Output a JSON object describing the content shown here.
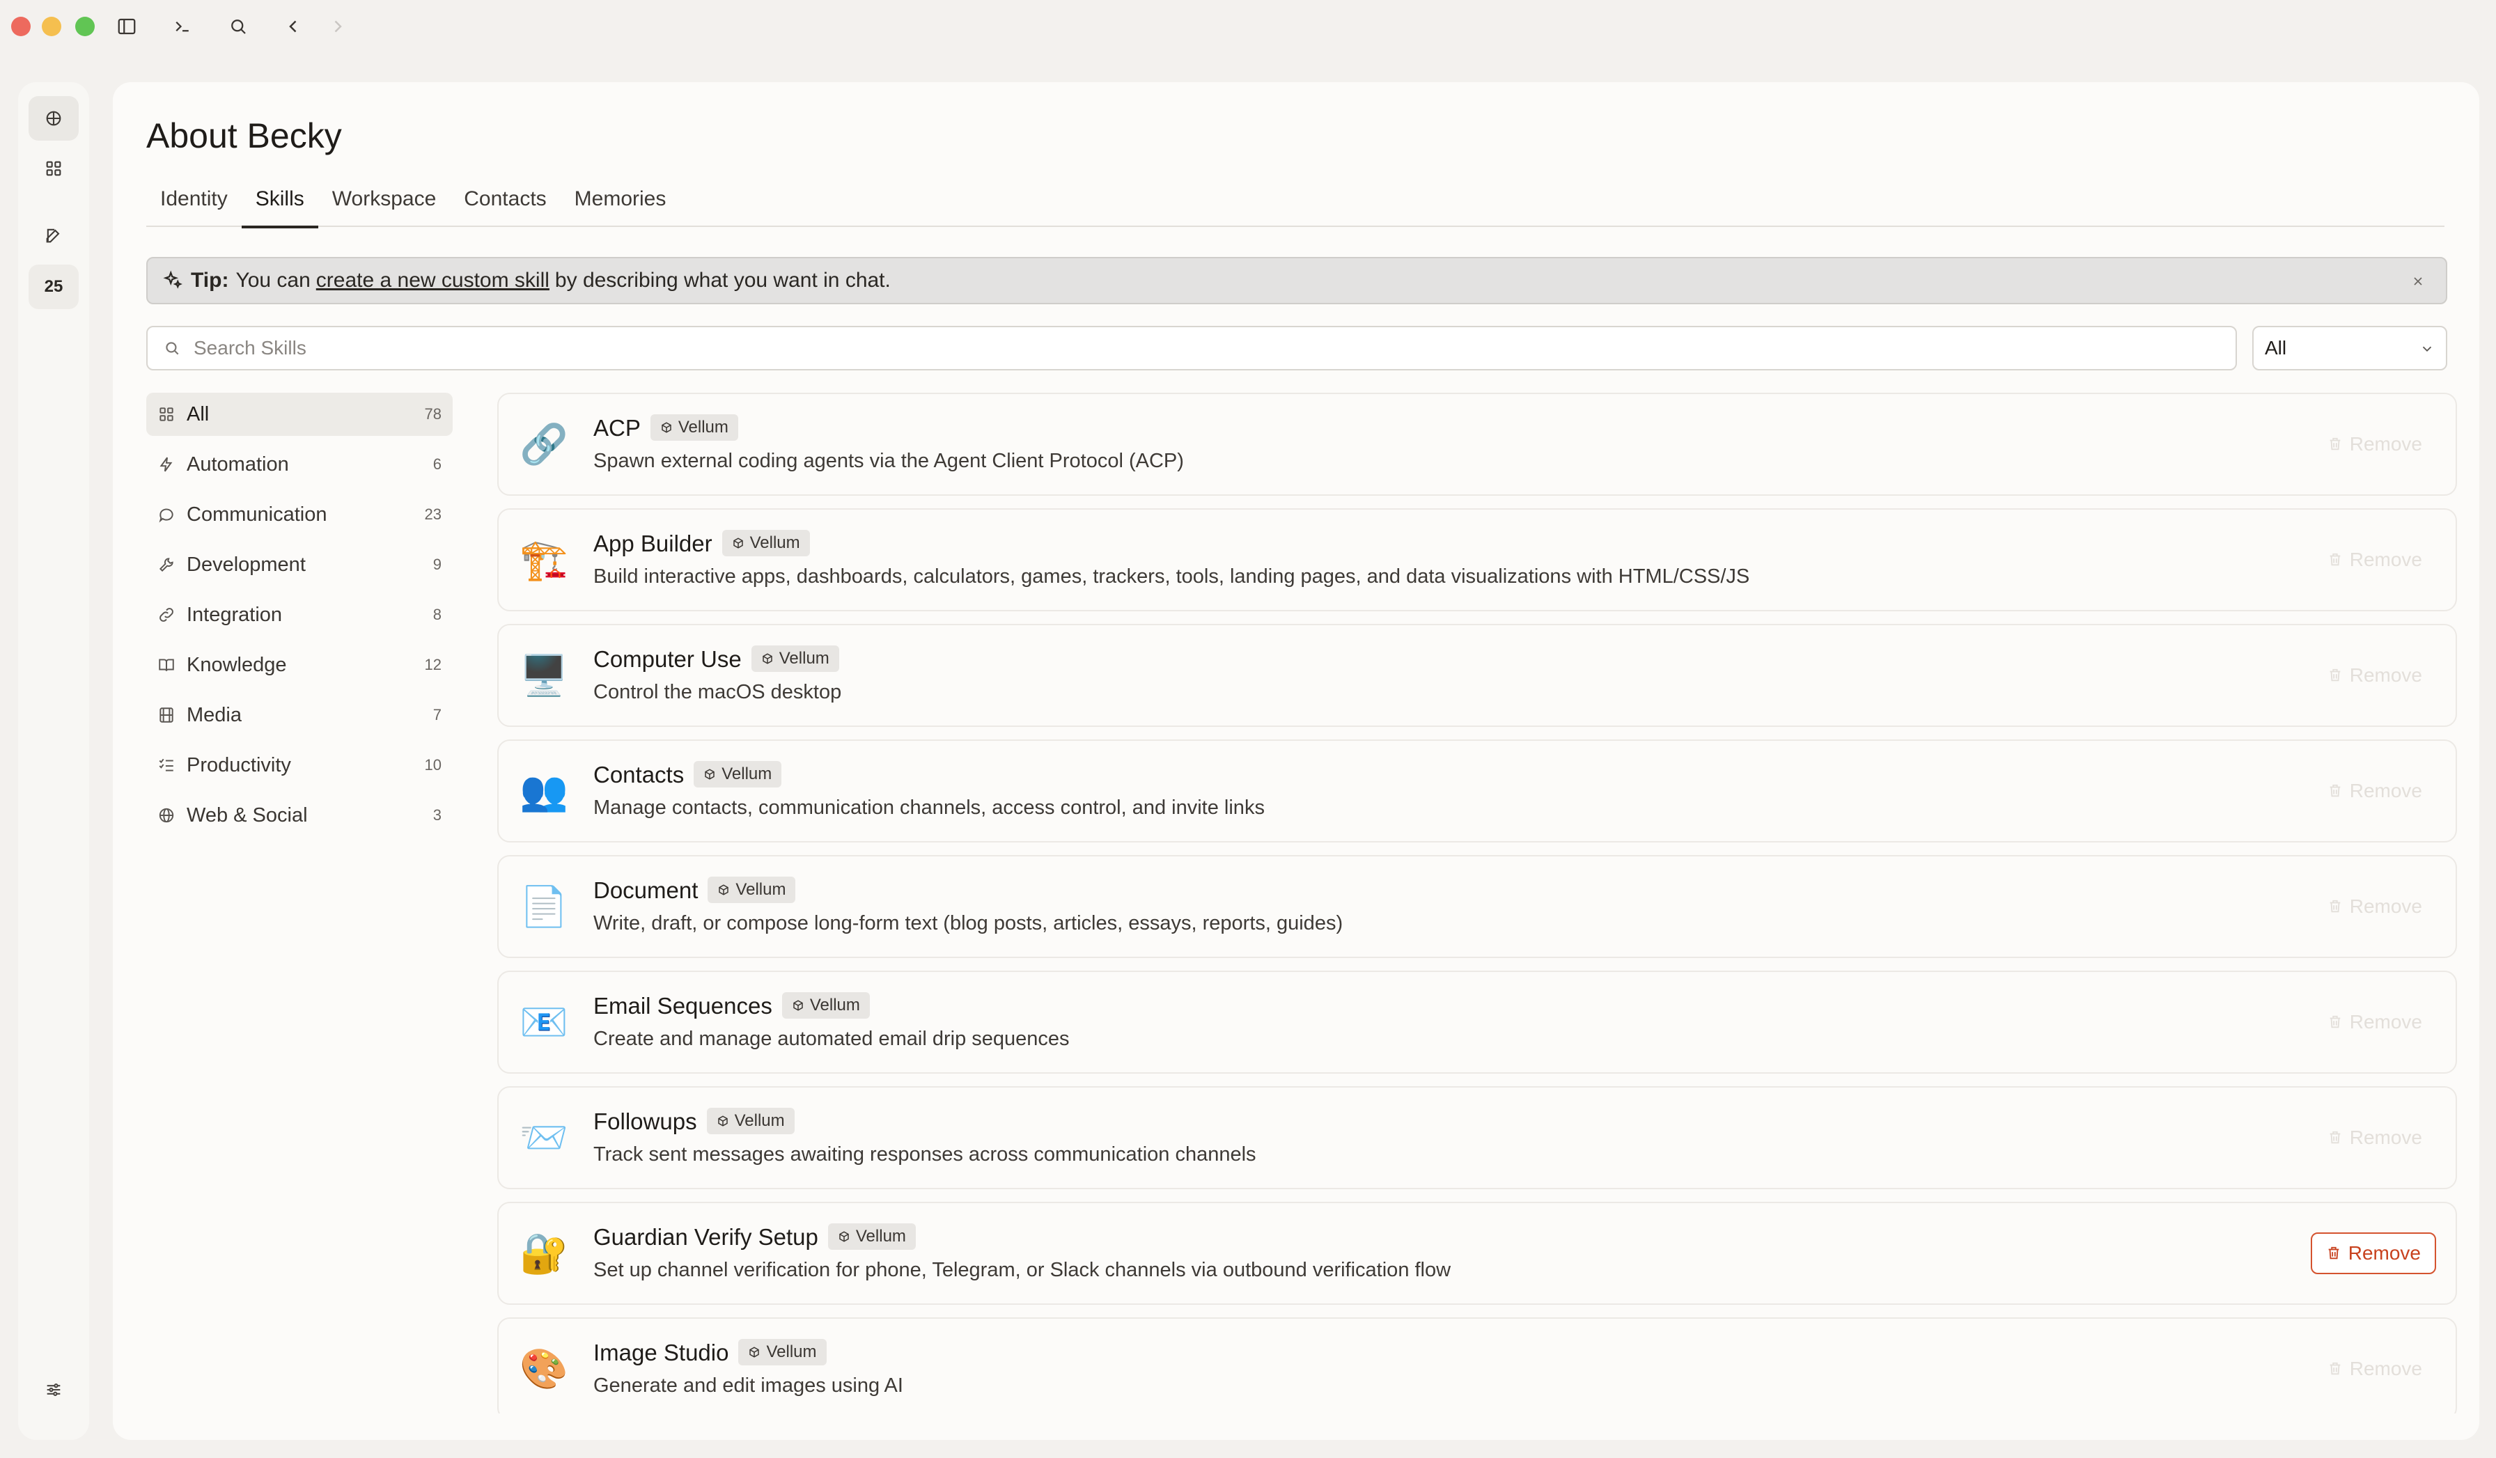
{
  "page": {
    "title": "About Becky",
    "tabs": [
      "Identity",
      "Skills",
      "Workspace",
      "Contacts",
      "Memories"
    ],
    "selected_tab": "Skills"
  },
  "rail": {
    "badge": "25"
  },
  "tip": {
    "bold": "Tip:",
    "text_before": "You can",
    "link": "create a new custom skill",
    "text_after": "by describing what you want in chat."
  },
  "search": {
    "placeholder": "Search Skills",
    "filter_value": "All"
  },
  "categories": [
    {
      "label": "All",
      "count": "78",
      "icon": "grid-icon"
    },
    {
      "label": "Automation",
      "count": "6",
      "icon": "bolt-icon"
    },
    {
      "label": "Communication",
      "count": "23",
      "icon": "chat-bubble-icon"
    },
    {
      "label": "Development",
      "count": "9",
      "icon": "wrench-icon"
    },
    {
      "label": "Integration",
      "count": "8",
      "icon": "link-icon"
    },
    {
      "label": "Knowledge",
      "count": "12",
      "icon": "book-icon"
    },
    {
      "label": "Media",
      "count": "7",
      "icon": "film-icon"
    },
    {
      "label": "Productivity",
      "count": "10",
      "icon": "checklist-icon"
    },
    {
      "label": "Web & Social",
      "count": "3",
      "icon": "globe-icon"
    }
  ],
  "skills": [
    {
      "name": "ACP",
      "badge": "Vellum",
      "desc": "Spawn external coding agents via the Agent Client Protocol (ACP)",
      "emoji": "🔗",
      "remove": "Remove"
    },
    {
      "name": "App Builder",
      "badge": "Vellum",
      "desc": "Build interactive apps, dashboards, calculators, games, trackers, tools, landing pages, and data visualizations with HTML/CSS/JS",
      "emoji": "🏗️",
      "remove": "Remove"
    },
    {
      "name": "Computer Use",
      "badge": "Vellum",
      "desc": "Control the macOS desktop",
      "emoji": "🖥️",
      "remove": "Remove"
    },
    {
      "name": "Contacts",
      "badge": "Vellum",
      "desc": "Manage contacts, communication channels, access control, and invite links",
      "emoji": "👥",
      "remove": "Remove"
    },
    {
      "name": "Document",
      "badge": "Vellum",
      "desc": "Write, draft, or compose long-form text (blog posts, articles, essays, reports, guides)",
      "emoji": "📄",
      "remove": "Remove"
    },
    {
      "name": "Email Sequences",
      "badge": "Vellum",
      "desc": "Create and manage automated email drip sequences",
      "emoji": "📧",
      "remove": "Remove"
    },
    {
      "name": "Followups",
      "badge": "Vellum",
      "desc": "Track sent messages awaiting responses across communication channels",
      "emoji": "📨",
      "remove": "Remove"
    },
    {
      "name": "Guardian Verify Setup",
      "badge": "Vellum",
      "desc": "Set up channel verification for phone, Telegram, or Slack channels via outbound verification flow",
      "emoji": "🔐",
      "remove": "Remove"
    },
    {
      "name": "Image Studio",
      "badge": "Vellum",
      "desc": "Generate and edit images using AI",
      "emoji": "🎨",
      "remove": "Remove"
    }
  ],
  "active_remove_index": 7,
  "colors": {
    "remove_active": "#c8421f",
    "traffic_red": "#ed6a5e",
    "traffic_yellow": "#f5bf4f",
    "traffic_green": "#61c554"
  }
}
